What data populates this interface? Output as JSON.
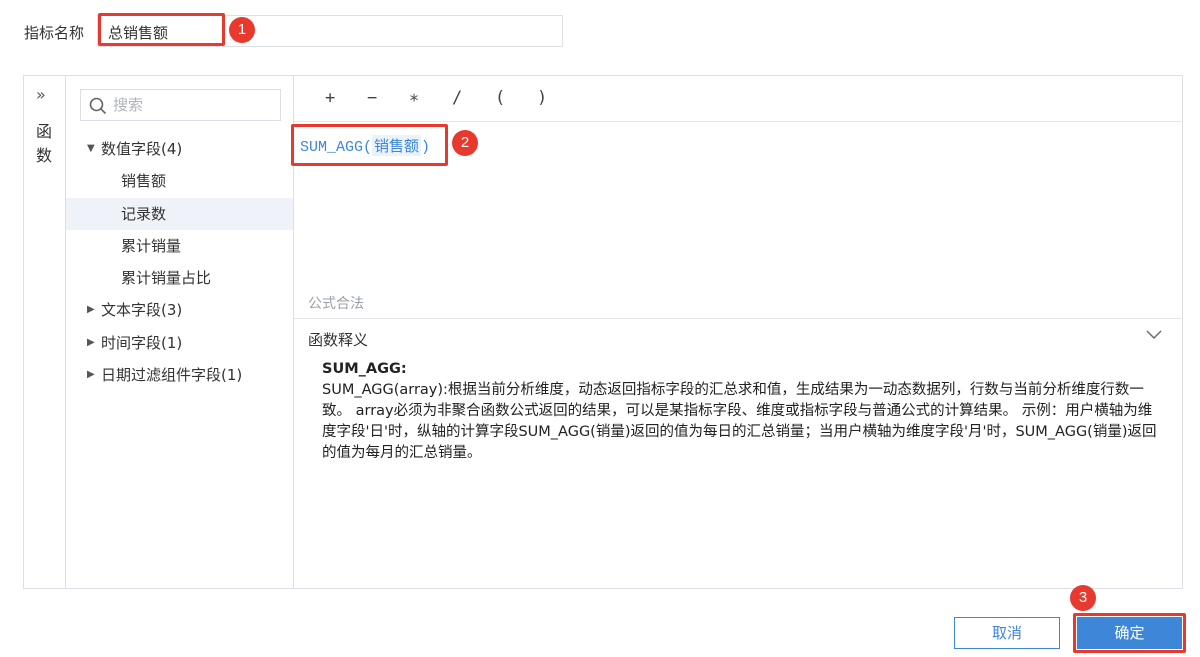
{
  "metric": {
    "label": "指标名称",
    "value": "总销售额"
  },
  "annotations": [
    "1",
    "2",
    "3"
  ],
  "sidebar": {
    "toggle_glyph": "»",
    "functions_label": "函数"
  },
  "search": {
    "placeholder": "搜索"
  },
  "tree": {
    "groups": [
      {
        "label": "数值字段(4)",
        "expanded": true,
        "items": [
          "销售额",
          "记录数",
          "累计销量",
          "累计销量占比"
        ],
        "selected_index": 1
      },
      {
        "label": "文本字段(3)",
        "expanded": false
      },
      {
        "label": "时间字段(1)",
        "expanded": false
      },
      {
        "label": "日期过滤组件字段(1)",
        "expanded": false
      }
    ]
  },
  "operators": [
    "+",
    "−",
    "∗",
    "/",
    "(",
    ")"
  ],
  "formula": {
    "function": "SUM_AGG",
    "open_paren": "(",
    "field": "销售额",
    "close_paren": ")"
  },
  "status": {
    "text": "公式合法"
  },
  "doc": {
    "title": "函数释义",
    "function_name": "SUM_AGG:",
    "description": "SUM_AGG(array):根据当前分析维度，动态返回指标字段的汇总求和值，生成结果为一动态数据列，行数与当前分析维度行数一致。  array必须为非聚合函数公式返回的结果，可以是某指标字段、维度或指标字段与普通公式的计算结果。  示例：用户横轴为维度字段'日'时，纵轴的计算字段SUM_AGG(销量)返回的值为每日的汇总销量；当用户横轴为维度字段'月'时，SUM_AGG(销量)返回的值为每月的汇总销量。"
  },
  "buttons": {
    "cancel": "取消",
    "ok": "确定"
  },
  "colors": {
    "accent": "#3d86d8",
    "highlight": "#e8392f",
    "selected_row": "#eff3f9"
  }
}
